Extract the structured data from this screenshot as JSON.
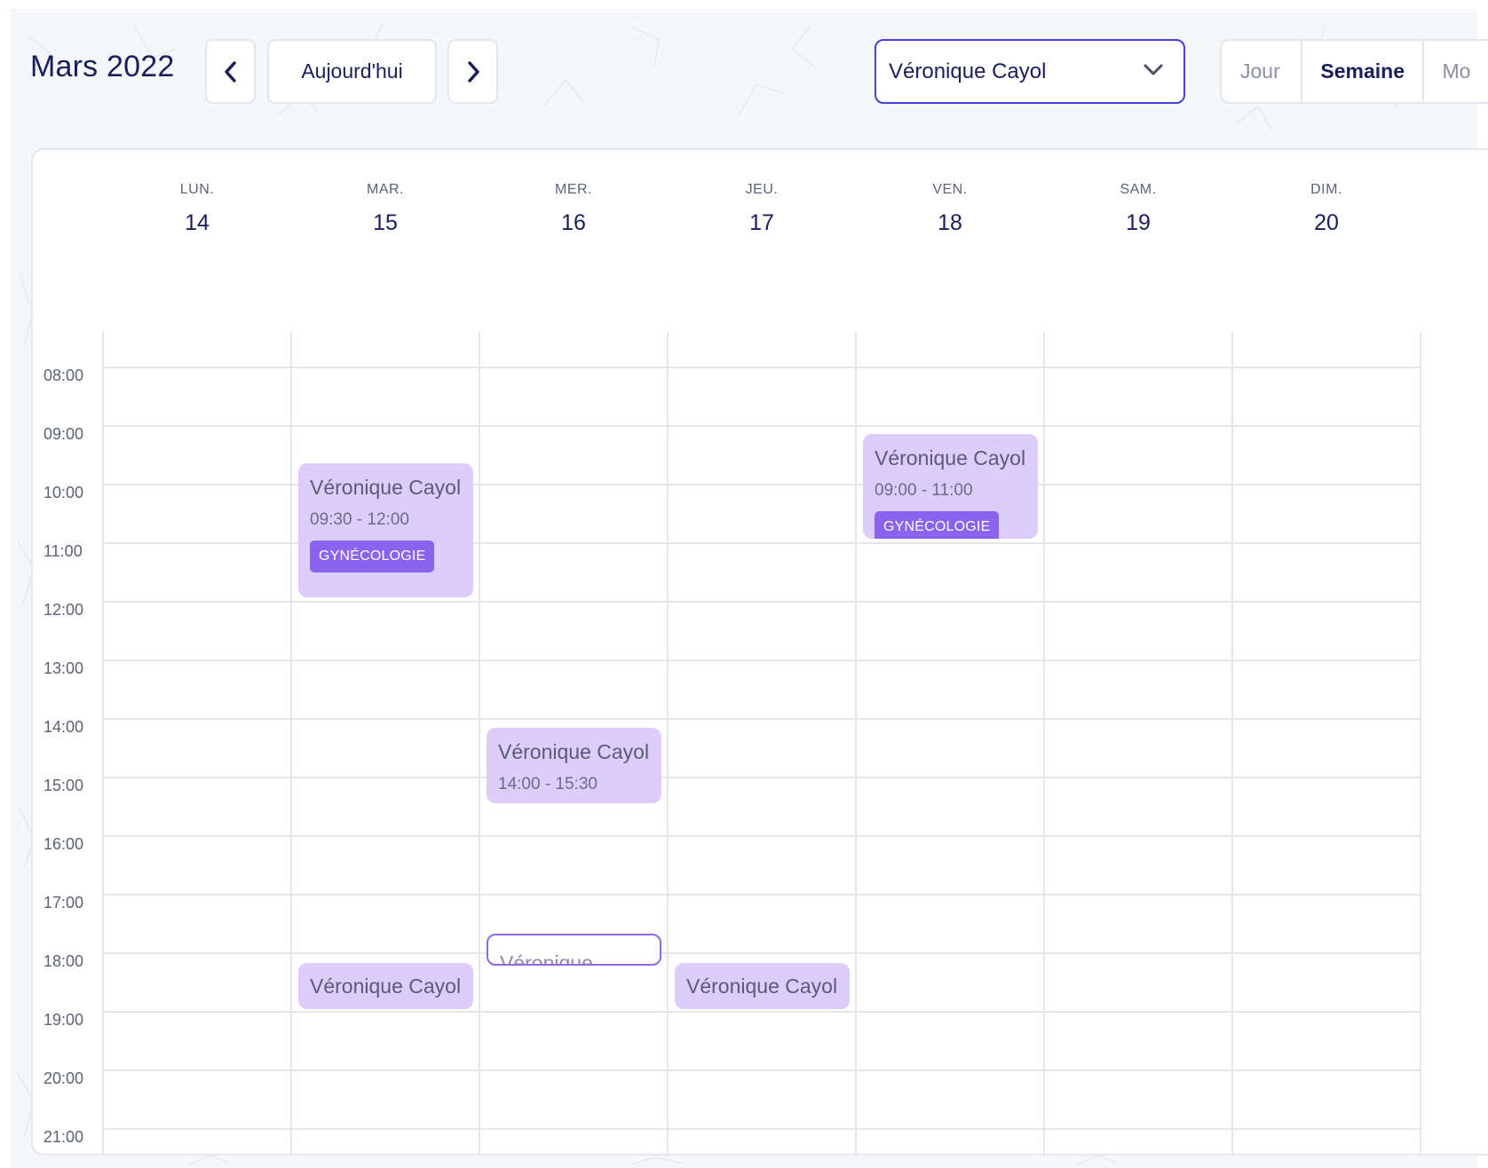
{
  "header": {
    "month_title": "Mars 2022",
    "today_label": "Aujourd'hui",
    "practitioner": "Véronique Cayol",
    "views": {
      "day": "Jour",
      "week": "Semaine",
      "month": "Mo"
    },
    "active_view": "Semaine"
  },
  "days": [
    {
      "name": "LUN.",
      "num": "14"
    },
    {
      "name": "MAR.",
      "num": "15"
    },
    {
      "name": "MER.",
      "num": "16"
    },
    {
      "name": "JEU.",
      "num": "17"
    },
    {
      "name": "VEN.",
      "num": "18"
    },
    {
      "name": "SAM.",
      "num": "19"
    },
    {
      "name": "DIM.",
      "num": "20"
    }
  ],
  "hours": [
    "08:00",
    "09:00",
    "10:00",
    "11:00",
    "12:00",
    "13:00",
    "14:00",
    "15:00",
    "16:00",
    "17:00",
    "18:00",
    "19:00",
    "20:00",
    "21:00"
  ],
  "events": [
    {
      "day": "MAR.",
      "name": "Véronique Cayol",
      "time": "09:30 - 12:00",
      "tag": "GYNÉCOLOGIE"
    },
    {
      "day": "VEN.",
      "name": "Véronique Cayol",
      "time": "09:00 - 11:00",
      "tag": "GYNÉCOLOGIE"
    },
    {
      "day": "MER.",
      "name": "Véronique Cayol",
      "time": "14:00 - 15:30"
    },
    {
      "day": "MER.",
      "name": "Véronique"
    },
    {
      "day": "MAR.",
      "name": "Véronique Cayol"
    },
    {
      "day": "JEU.",
      "name": "Véronique Cayol"
    }
  ],
  "colors": {
    "primary_text": "#1a1f5c",
    "accent_border": "#4b3fd6",
    "event_bg": "#dccdfa",
    "tag_bg": "#8a63ee"
  },
  "icons": {
    "prev": "chevron-left-icon",
    "next": "chevron-right-icon",
    "dropdown": "chevron-down-icon"
  }
}
